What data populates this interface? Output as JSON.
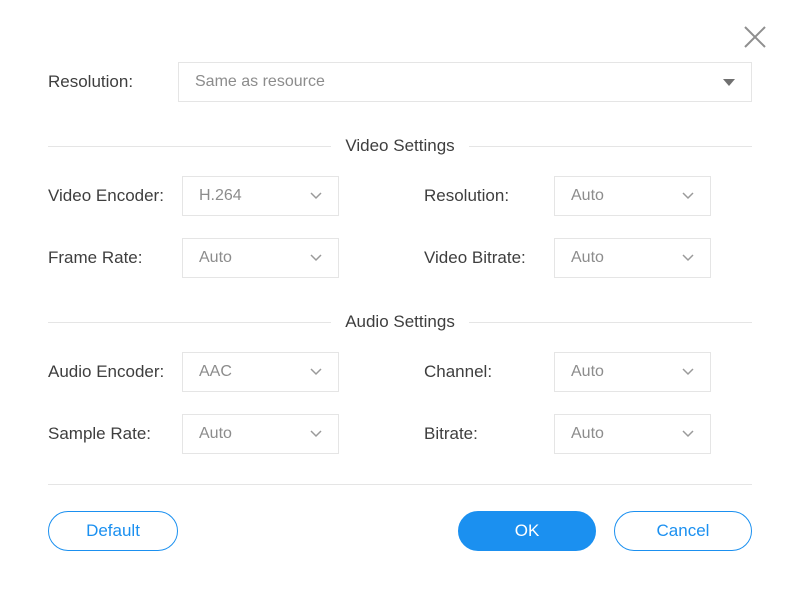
{
  "top": {
    "resolution_label": "Resolution:",
    "resolution_value": "Same as resource"
  },
  "video": {
    "section_title": "Video Settings",
    "encoder_label": "Video Encoder:",
    "encoder_value": "H.264",
    "resolution_label": "Resolution:",
    "resolution_value": "Auto",
    "frame_rate_label": "Frame Rate:",
    "frame_rate_value": "Auto",
    "bitrate_label": "Video Bitrate:",
    "bitrate_value": "Auto"
  },
  "audio": {
    "section_title": "Audio Settings",
    "encoder_label": "Audio Encoder:",
    "encoder_value": "AAC",
    "channel_label": "Channel:",
    "channel_value": "Auto",
    "sample_rate_label": "Sample Rate:",
    "sample_rate_value": "Auto",
    "bitrate_label": "Bitrate:",
    "bitrate_value": "Auto"
  },
  "buttons": {
    "default": "Default",
    "ok": "OK",
    "cancel": "Cancel"
  }
}
